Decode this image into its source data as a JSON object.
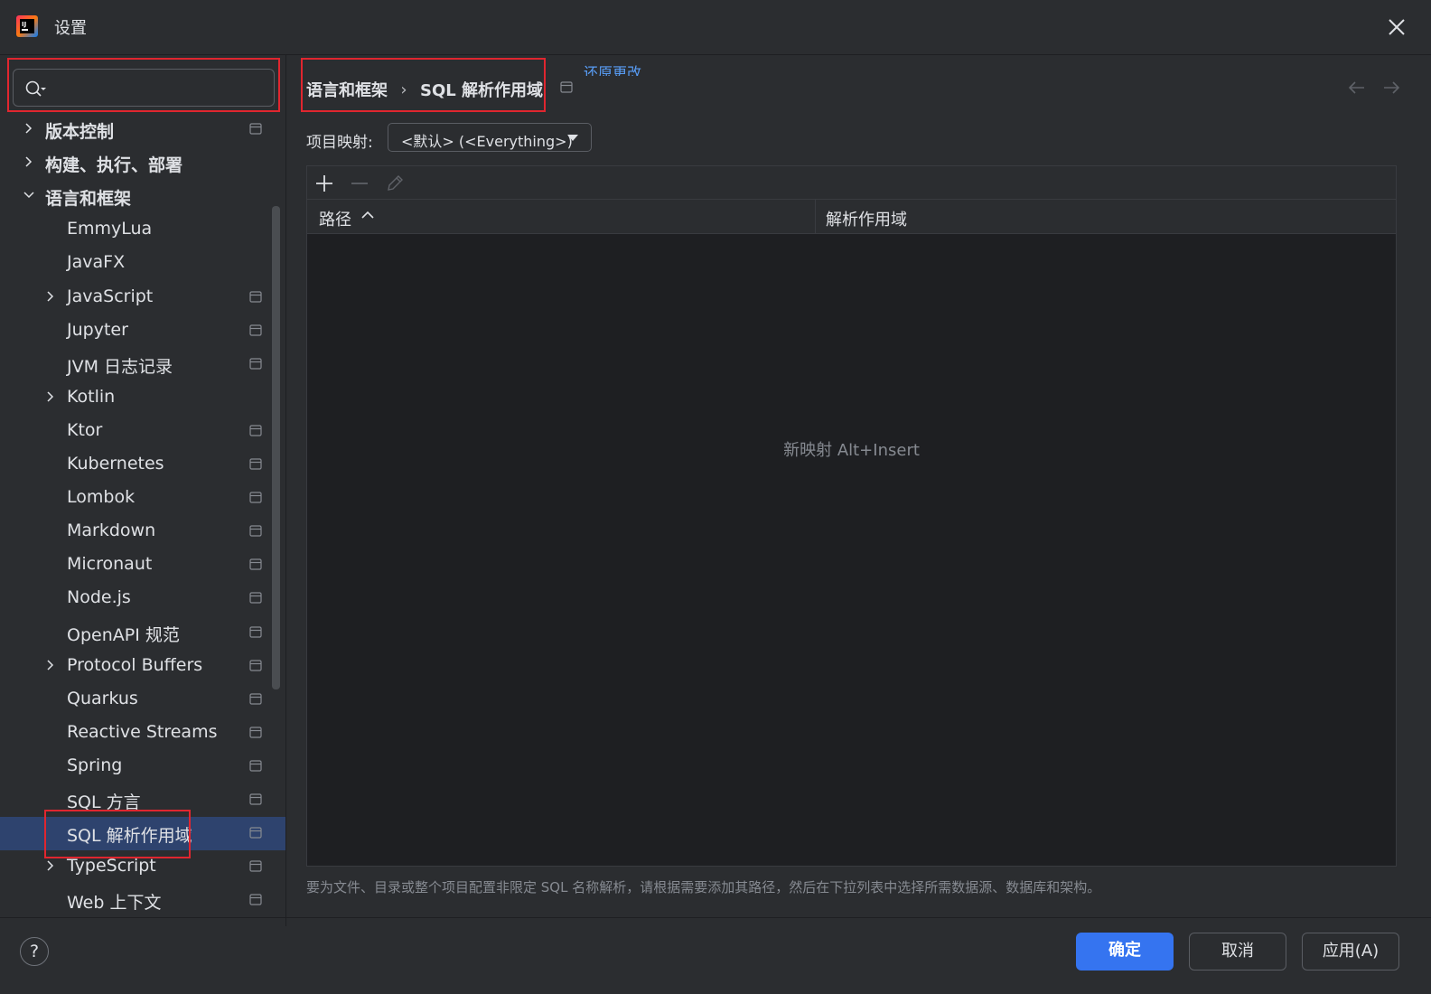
{
  "window": {
    "title": "设置",
    "logo_icon": "intellij-idea-logo-icon",
    "close_icon": "close-icon"
  },
  "search": {
    "placeholder": "",
    "value": ""
  },
  "sidebar": {
    "items": [
      {
        "label": "版本控制",
        "level": 0,
        "expandable": true,
        "expanded": false,
        "bold": true,
        "project_icon": true
      },
      {
        "label": "构建、执行、部署",
        "level": 0,
        "expandable": true,
        "expanded": false,
        "bold": true,
        "project_icon": false
      },
      {
        "label": "语言和框架",
        "level": 0,
        "expandable": true,
        "expanded": true,
        "bold": true,
        "project_icon": false
      },
      {
        "label": "EmmyLua",
        "level": 1,
        "expandable": false,
        "project_icon": false
      },
      {
        "label": "JavaFX",
        "level": 1,
        "expandable": false,
        "project_icon": false
      },
      {
        "label": "JavaScript",
        "level": 1,
        "expandable": true,
        "expanded": false,
        "project_icon": true
      },
      {
        "label": "Jupyter",
        "level": 1,
        "expandable": false,
        "project_icon": true
      },
      {
        "label": "JVM 日志记录",
        "level": 1,
        "expandable": false,
        "project_icon": true
      },
      {
        "label": "Kotlin",
        "level": 1,
        "expandable": true,
        "expanded": false,
        "project_icon": false
      },
      {
        "label": "Ktor",
        "level": 1,
        "expandable": false,
        "project_icon": true
      },
      {
        "label": "Kubernetes",
        "level": 1,
        "expandable": false,
        "project_icon": true
      },
      {
        "label": "Lombok",
        "level": 1,
        "expandable": false,
        "project_icon": true
      },
      {
        "label": "Markdown",
        "level": 1,
        "expandable": false,
        "project_icon": true
      },
      {
        "label": "Micronaut",
        "level": 1,
        "expandable": false,
        "project_icon": true
      },
      {
        "label": "Node.js",
        "level": 1,
        "expandable": false,
        "project_icon": true
      },
      {
        "label": "OpenAPI 规范",
        "level": 1,
        "expandable": false,
        "project_icon": true
      },
      {
        "label": "Protocol Buffers",
        "level": 1,
        "expandable": true,
        "expanded": false,
        "project_icon": true
      },
      {
        "label": "Quarkus",
        "level": 1,
        "expandable": false,
        "project_icon": true
      },
      {
        "label": "Reactive Streams",
        "level": 1,
        "expandable": false,
        "project_icon": true
      },
      {
        "label": "Spring",
        "level": 1,
        "expandable": false,
        "project_icon": true
      },
      {
        "label": "SQL 方言",
        "level": 1,
        "expandable": false,
        "project_icon": true
      },
      {
        "label": "SQL 解析作用域",
        "level": 1,
        "expandable": false,
        "project_icon": true,
        "selected": true
      },
      {
        "label": "TypeScript",
        "level": 1,
        "expandable": true,
        "expanded": false,
        "project_icon": true
      },
      {
        "label": "Web 上下文",
        "level": 1,
        "expandable": false,
        "project_icon": true
      }
    ]
  },
  "breadcrumb": {
    "parent": "语言和框架",
    "separator": "›",
    "current": "SQL 解析作用域"
  },
  "reset_link": "还原更改",
  "mapping": {
    "label": "项目映射:",
    "selected": "<默认> (<Everything>)"
  },
  "table": {
    "columns": [
      "路径",
      "解析作用域"
    ],
    "rows": [],
    "empty_text": "新映射 Alt+Insert"
  },
  "hint": "要为文件、目录或整个项目配置非限定 SQL 名称解析，请根据需要添加其路径，然后在下拉列表中选择所需数据源、数据库和架构。",
  "footer": {
    "help": "?",
    "ok": "确定",
    "cancel": "取消",
    "apply": "应用(A)"
  },
  "colors": {
    "accent": "#3574f0",
    "selection": "#2e436e",
    "highlight_box": "#e0262f",
    "link": "#589df6"
  }
}
